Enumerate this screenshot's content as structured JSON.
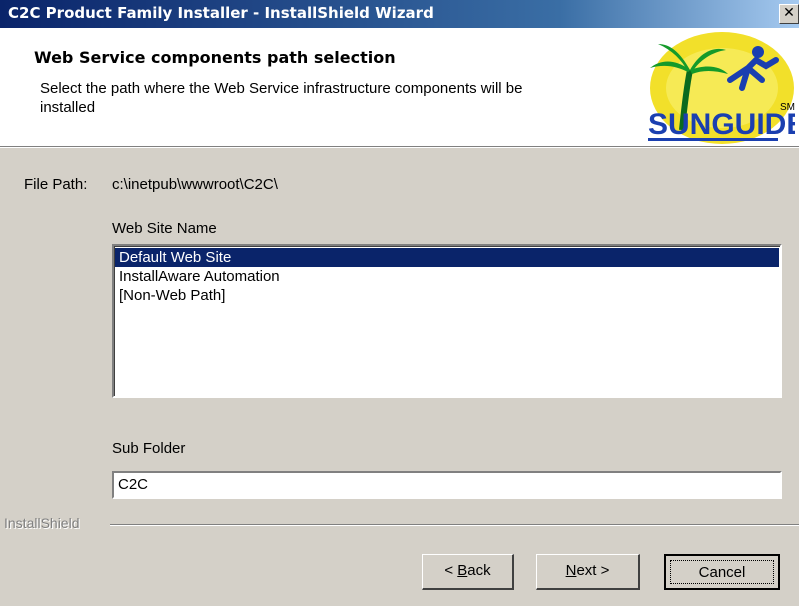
{
  "window": {
    "title": "C2C Product Family Installer - InstallShield Wizard",
    "close_glyph": "✕"
  },
  "header": {
    "title": "Web Service components path selection",
    "subtitle": "Select the path where the Web Service infrastructure components will be installed",
    "logo": {
      "icon": "sunguide-logo",
      "text": "SUNGUIDE",
      "mark": "SM"
    }
  },
  "file_path": {
    "label": "File Path:",
    "value": "c:\\inetpub\\wwwroot\\C2C\\"
  },
  "web_site": {
    "label": "Web Site Name",
    "items": [
      "Default Web Site",
      "InstallAware Automation",
      "[Non-Web Path]"
    ],
    "selected": "Default Web Site"
  },
  "sub_folder": {
    "label": "Sub Folder",
    "value": "C2C"
  },
  "brand": "InstallShield",
  "buttons": {
    "back_prefix": "< ",
    "back_key": "B",
    "back_rest": "ack",
    "next_key": "N",
    "next_rest": "ext >",
    "cancel": "Cancel"
  },
  "colors": {
    "titlebar": "#0a246a",
    "selection": "#0a246a",
    "face": "#d4d0c8"
  }
}
